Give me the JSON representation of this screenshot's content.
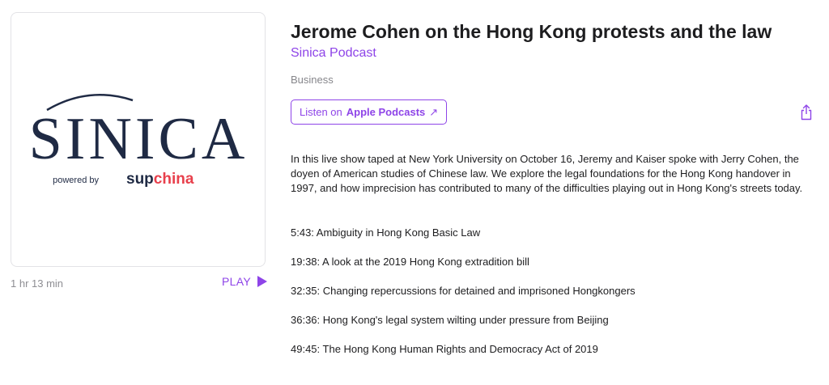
{
  "artwork": {
    "logo_text": "SINICA",
    "powered_by": "powered by",
    "brand_prefix": "sup",
    "brand_suffix": "china"
  },
  "episode": {
    "title": "Jerome Cohen on the Hong Kong protests and the law",
    "podcast": "Sinica Podcast",
    "category": "Business",
    "duration": "1 hr 13 min",
    "play_label": "PLAY",
    "listen_prefix": "Listen on",
    "listen_strong": "Apple Podcasts",
    "listen_arrow": "↗",
    "description": "In this live show taped at New York University on October 16, Jeremy and Kaiser spoke with Jerry Cohen, the doyen of American studies of Chinese law. We explore the legal foundations for the Hong Kong handover in 1997, and how imprecision has contributed to many of the difficulties playing out in Hong Kong's streets today.",
    "chapters": [
      "5:43: Ambiguity in Hong Kong Basic Law",
      "19:38: A look at the 2019 Hong Kong extradition bill",
      "32:35: Changing repercussions for detained and imprisoned Hongkongers",
      "36:36: Hong Kong's legal system wilting under pressure from Beijing",
      "49:45: The Hong Kong Human Rights and Democracy Act of 2019"
    ]
  },
  "colors": {
    "accent": "#8e44e8",
    "logo_navy": "#1f2a44",
    "brand_red": "#e8404c"
  },
  "icons": {
    "play": "play-icon",
    "share": "share-icon",
    "external": "arrow-up-right-icon"
  }
}
